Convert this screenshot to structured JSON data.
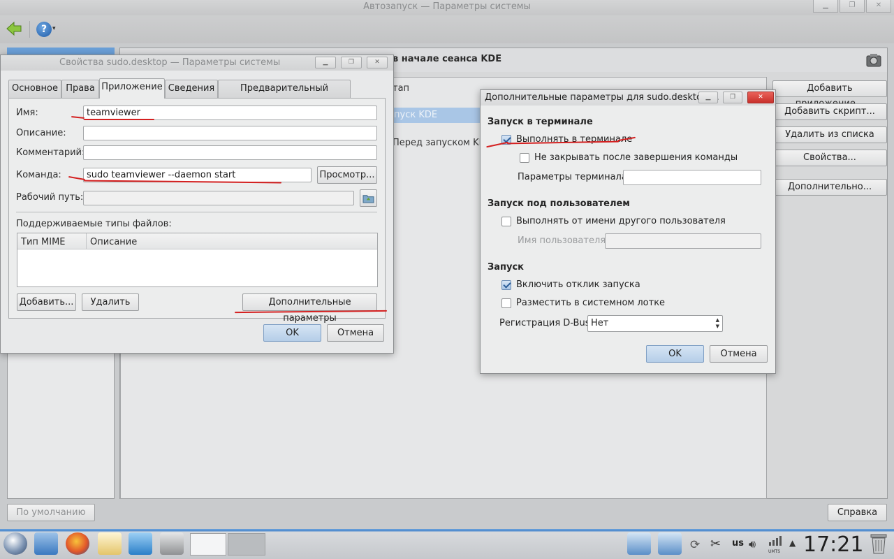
{
  "main_window": {
    "title": "Автозапуск — Параметры системы",
    "header_text": "в начале сеанса KDE",
    "list_rows": [
      "тап",
      "пуск KDE",
      "Перед запуском KDE"
    ],
    "side_buttons": [
      "Добавить приложение...",
      "Добавить скрипт...",
      "Удалить из списка",
      "Свойства...",
      "Дополнительно..."
    ],
    "defaults_button": "По умолчанию",
    "help_button": "Справка",
    "help_icon_glyph": "?",
    "help_icon_arrow": "▾"
  },
  "properties_dialog": {
    "title": "Свойства sudo.desktop — Параметры системы",
    "tabs": [
      "Основное",
      "Права",
      "Приложение",
      "Сведения",
      "Предварительный просмотр"
    ],
    "active_tab": "Приложение",
    "fields": {
      "name_label": "Имя:",
      "name_value": "teamviewer",
      "description_label": "Описание:",
      "description_value": "",
      "comment_label": "Комментарий:",
      "comment_value": "",
      "command_label": "Команда:",
      "command_value": "sudo teamviewer --daemon start",
      "workdir_label": "Рабочий путь:",
      "workdir_value": ""
    },
    "browse_button": "Просмотр...",
    "file_types_label": "Поддерживаемые типы файлов:",
    "mime_columns": [
      "Тип MIME",
      "Описание"
    ],
    "add_button": "Добавить...",
    "remove_button": "Удалить",
    "advanced_button": "Дополнительные параметры",
    "ok_button": "OK",
    "cancel_button": "Отмена"
  },
  "advanced_dialog": {
    "title": "Дополнительные параметры для sudo.desktop ...",
    "terminal_section": "Запуск в терминале",
    "run_in_terminal": {
      "label": "Выполнять в терминале",
      "checked": true
    },
    "no_close": {
      "label": "Не закрывать после завершения команды",
      "checked": false
    },
    "terminal_params_label": "Параметры терминала:",
    "terminal_params_value": "",
    "user_section": "Запуск под пользователем",
    "run_as_other": {
      "label": "Выполнять от имени другого пользователя",
      "checked": false
    },
    "username_label": "Имя пользователя:",
    "username_value": "",
    "launch_section": "Запуск",
    "launch_feedback": {
      "label": "Включить отклик запуска",
      "checked": true
    },
    "system_tray": {
      "label": "Разместить в системном лотке",
      "checked": false
    },
    "dbus_label": "Регистрация D-Bus:",
    "dbus_value": "Нет",
    "ok_button": "OK",
    "cancel_button": "Отмена"
  },
  "taskbar": {
    "layout_indicator": "us",
    "network_label": "UMTS",
    "clock": "17:21"
  },
  "colors": {
    "annotation_red": "#d42020",
    "selection_blue": "#a9c6e6",
    "taskbar_accent": "#4c88cc"
  }
}
